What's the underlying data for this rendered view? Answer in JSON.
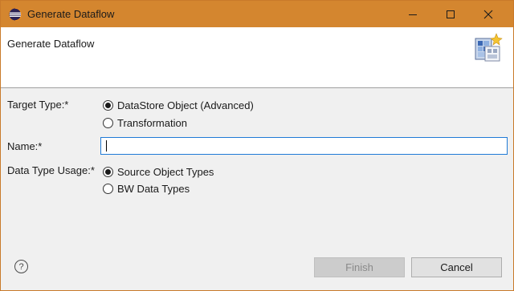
{
  "window": {
    "title": "Generate Dataflow",
    "accent_color": "#d4862f",
    "controls": {
      "minimize_icon": "minimize-icon",
      "maximize_icon": "maximize-icon",
      "close_icon": "close-icon"
    }
  },
  "header": {
    "title": "Generate Dataflow",
    "icon": "wizard-banner-icon"
  },
  "form": {
    "target_type": {
      "label": "Target Type:*",
      "options": [
        {
          "label": "DataStore Object (Advanced)",
          "checked": true
        },
        {
          "label": "Transformation",
          "checked": false
        }
      ]
    },
    "name": {
      "label": "Name:*",
      "value": "",
      "placeholder": ""
    },
    "data_type_usage": {
      "label": "Data Type Usage:*",
      "options": [
        {
          "label": "Source Object Types",
          "checked": true
        },
        {
          "label": "BW Data Types",
          "checked": false
        }
      ]
    }
  },
  "footer": {
    "help_label": "?",
    "finish_label": "Finish",
    "finish_enabled": false,
    "cancel_label": "Cancel"
  }
}
